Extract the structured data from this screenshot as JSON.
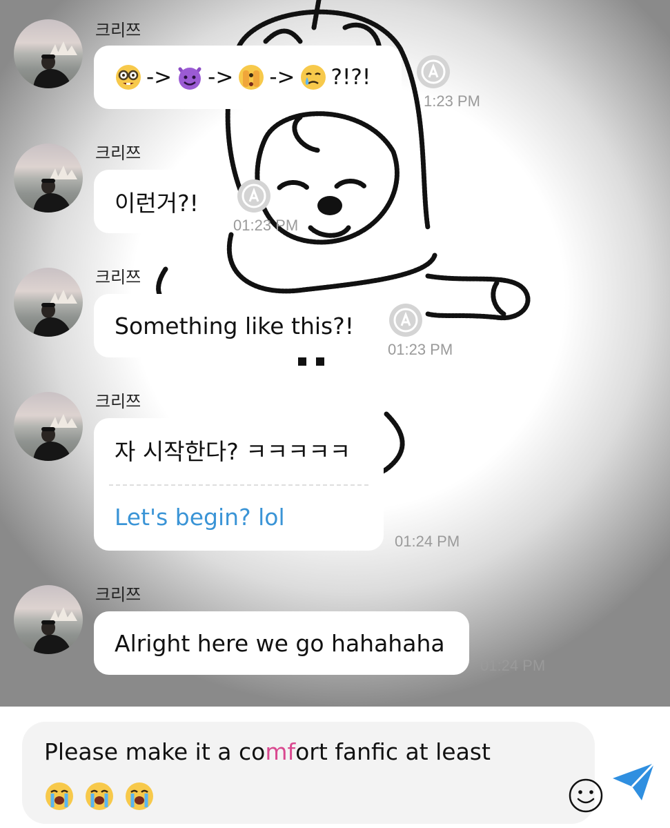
{
  "messages": [
    {
      "sender": "크리쯔",
      "text_after": "?!?!",
      "time": "1:23 PM"
    },
    {
      "sender": "크리쯔",
      "text": "이런거?!",
      "time": "01:23 PM"
    },
    {
      "sender": "크리쯔",
      "text": "Something like this?!",
      "time": "01:23 PM"
    },
    {
      "sender": "크리쯔",
      "text": "자 시작한다? ㅋㅋㅋㅋㅋ",
      "translation": "Let's begin? lol",
      "time": "01:24 PM"
    },
    {
      "sender": "크리쯔",
      "text": "Alright here we go hahahaha",
      "time": "01:24 PM"
    }
  ],
  "emoji_sequence": [
    "nerd-face",
    "smiling-devil",
    "face-with-peeking-eye",
    "crying-face"
  ],
  "arrow": "->",
  "composer": {
    "text_before": "Please make it a co",
    "text_highlight": "mf",
    "text_after": "ort fanfic at least",
    "emojis": [
      "loudly-crying-face",
      "loudly-crying-face",
      "loudly-crying-face"
    ]
  },
  "colors": {
    "translation": "#3a94d6",
    "highlight": "#d9488f",
    "send": "#2f8fe0"
  }
}
